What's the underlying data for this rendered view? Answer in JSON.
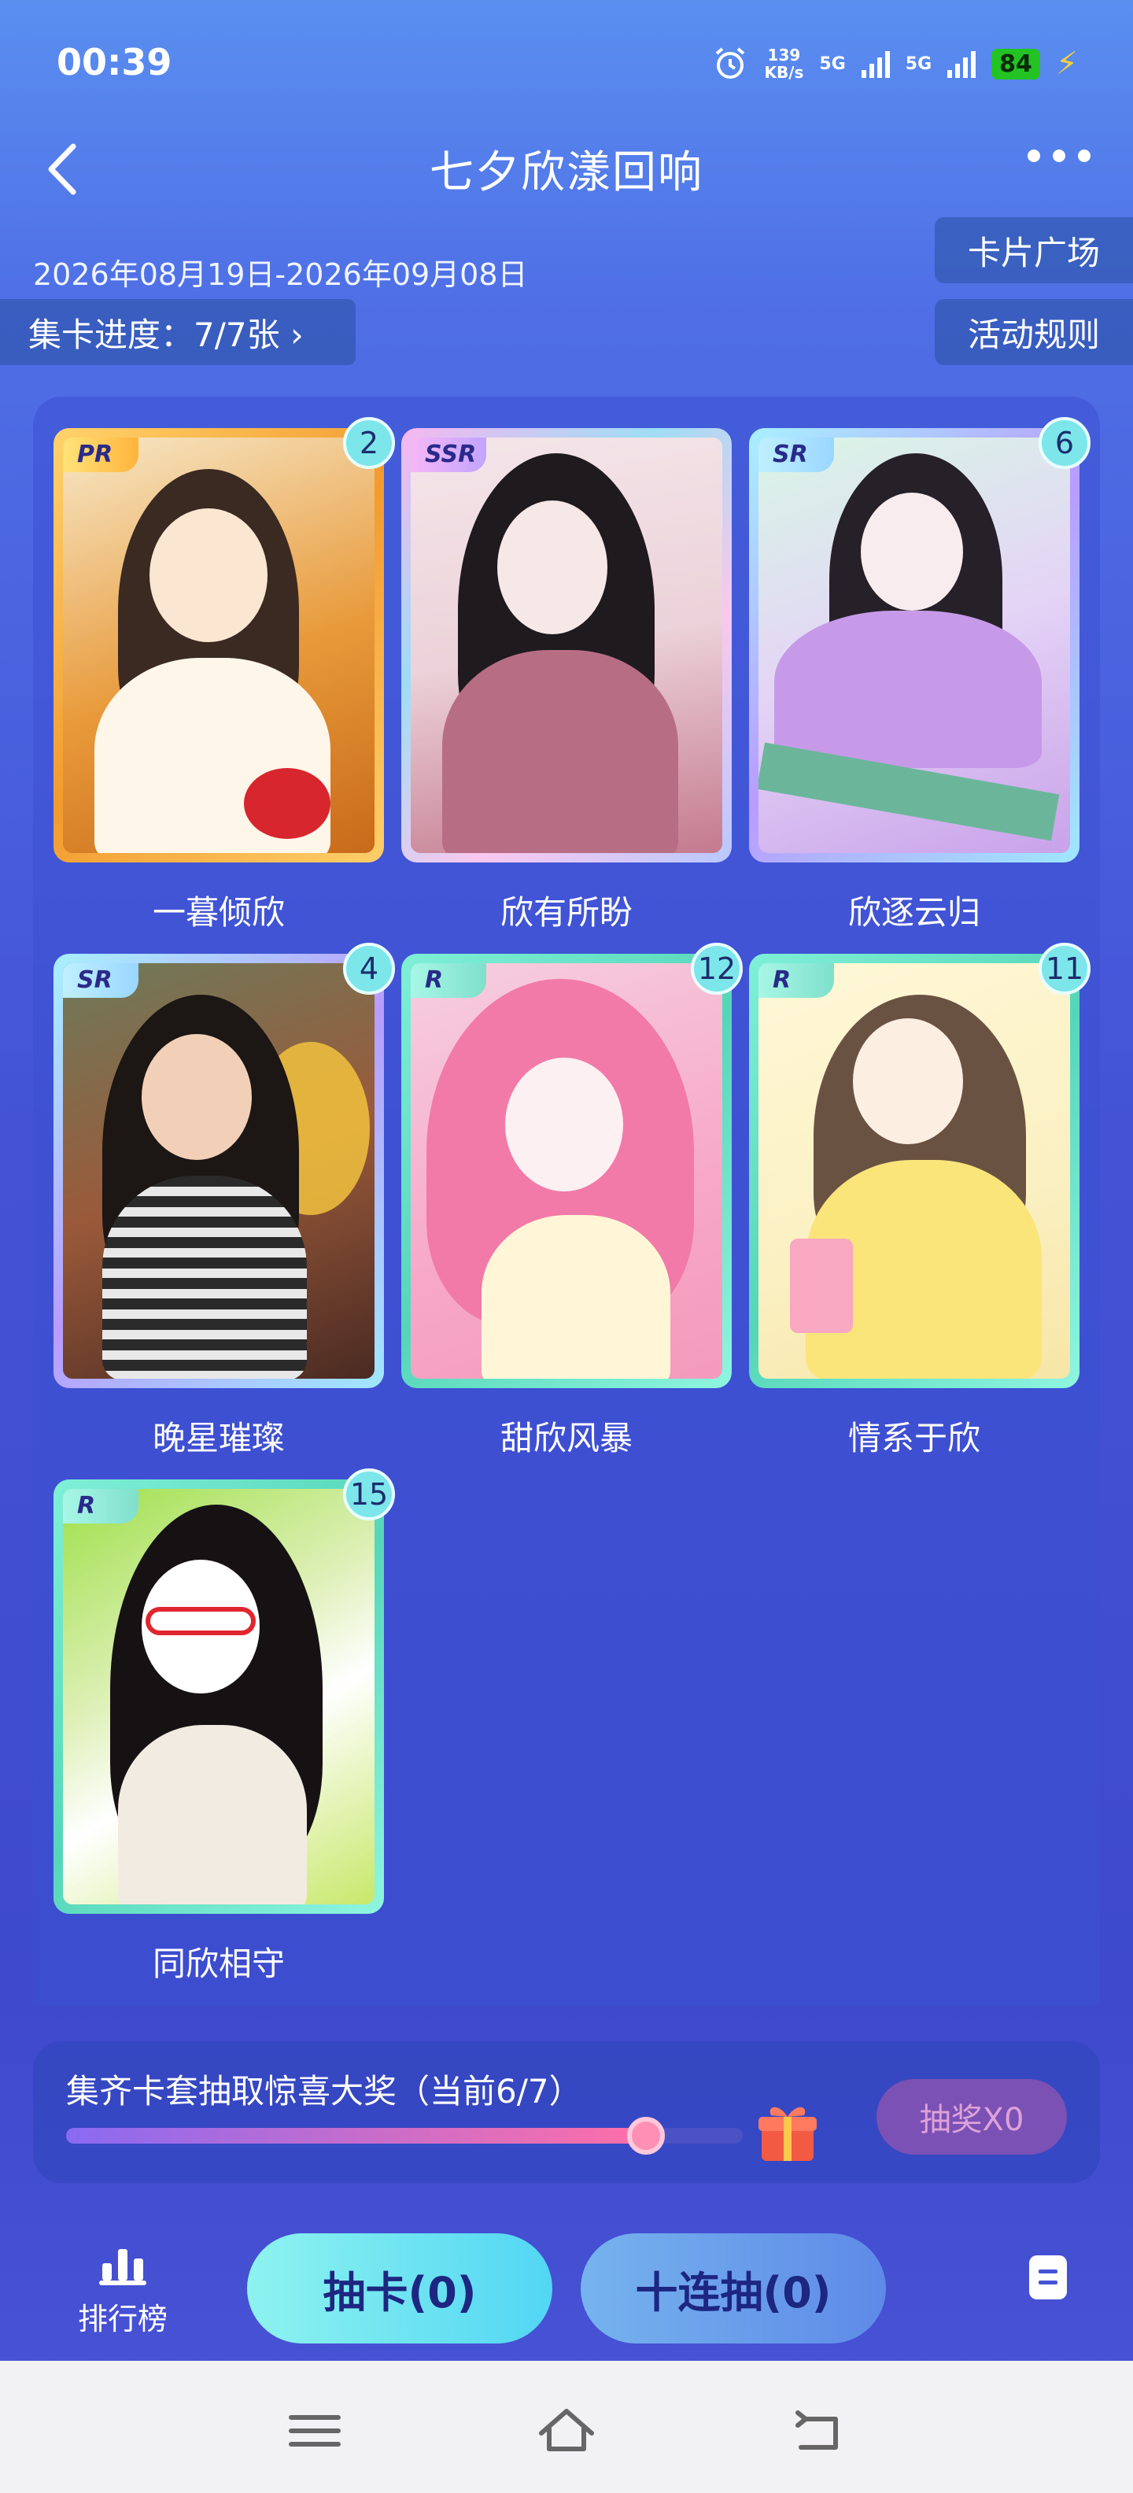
{
  "status_bar": {
    "time": "00:39",
    "net_speed_value": "139",
    "net_speed_unit": "KB/s",
    "sim1": "5G",
    "sim2": "5G",
    "battery": "84"
  },
  "header": {
    "title": "七夕欣漾回响"
  },
  "event": {
    "date_range": "2026年08月19日-2026年09月08日",
    "progress_label": "集卡进度：7/7张 ›"
  },
  "side_buttons": {
    "card_plaza": "卡片广场",
    "rules": "活动规则"
  },
  "cards": [
    {
      "name": "一暮倾欣",
      "rarity": "PR",
      "count": "2"
    },
    {
      "name": "欣有所盼",
      "rarity": "SSR",
      "count": ""
    },
    {
      "name": "欣逐云归",
      "rarity": "SR",
      "count": "6"
    },
    {
      "name": "晚星璀璨",
      "rarity": "SR",
      "count": "4"
    },
    {
      "name": "甜欣风暴",
      "rarity": "R",
      "count": "12"
    },
    {
      "name": "情系于欣",
      "rarity": "R",
      "count": "11"
    },
    {
      "name": "同欣相守",
      "rarity": "R",
      "count": "15"
    }
  ],
  "bonus": {
    "text": "集齐卡套抽取惊喜大奖（当前6/7）",
    "progress": 0.857,
    "button": "抽奖X0"
  },
  "bottom": {
    "ranking": "排行榜",
    "draw": "抽卡(0)",
    "ten_draw": "十连抽(0)"
  },
  "colors": {
    "accent_cyan": "#7de6ea",
    "gold_frame": "#f5b13a"
  }
}
